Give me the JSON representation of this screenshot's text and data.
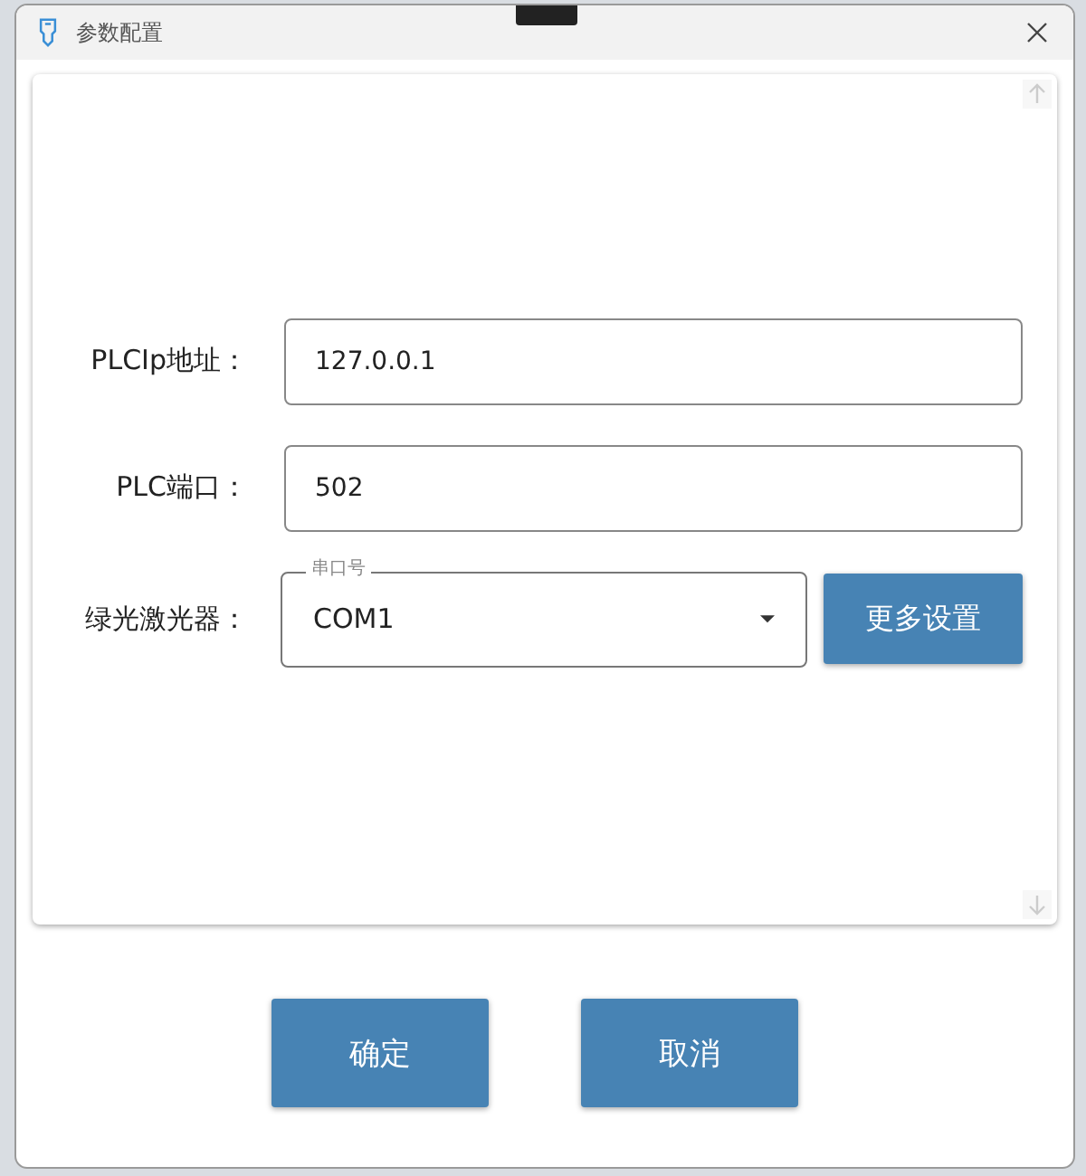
{
  "window": {
    "title": "参数配置"
  },
  "fields": [
    {
      "kind": "text",
      "label": "PLCIp地址：",
      "value": "127.0.0.1"
    },
    {
      "kind": "text",
      "label": "PLC端口：",
      "value": "502"
    },
    {
      "kind": "select",
      "label": "绿光激光器：",
      "caption": "串口号",
      "value": "COM1",
      "button": "更多设置"
    }
  ],
  "buttons": [
    "确定",
    "取消"
  ]
}
